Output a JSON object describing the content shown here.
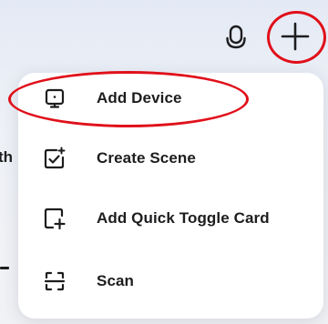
{
  "background": {
    "peek_text": "th"
  },
  "topbar": {
    "mic_icon": "microphone-icon",
    "add_icon": "plus-icon"
  },
  "menu": {
    "items": [
      {
        "label": "Add Device",
        "icon": "device-icon"
      },
      {
        "label": "Create Scene",
        "icon": "scene-check-icon"
      },
      {
        "label": "Add Quick Toggle Card",
        "icon": "add-card-icon"
      },
      {
        "label": "Scan",
        "icon": "scan-icon"
      }
    ]
  },
  "colors": {
    "annotation": "#e0101a",
    "text": "#1d1d1f",
    "menu_bg": "#ffffff"
  }
}
